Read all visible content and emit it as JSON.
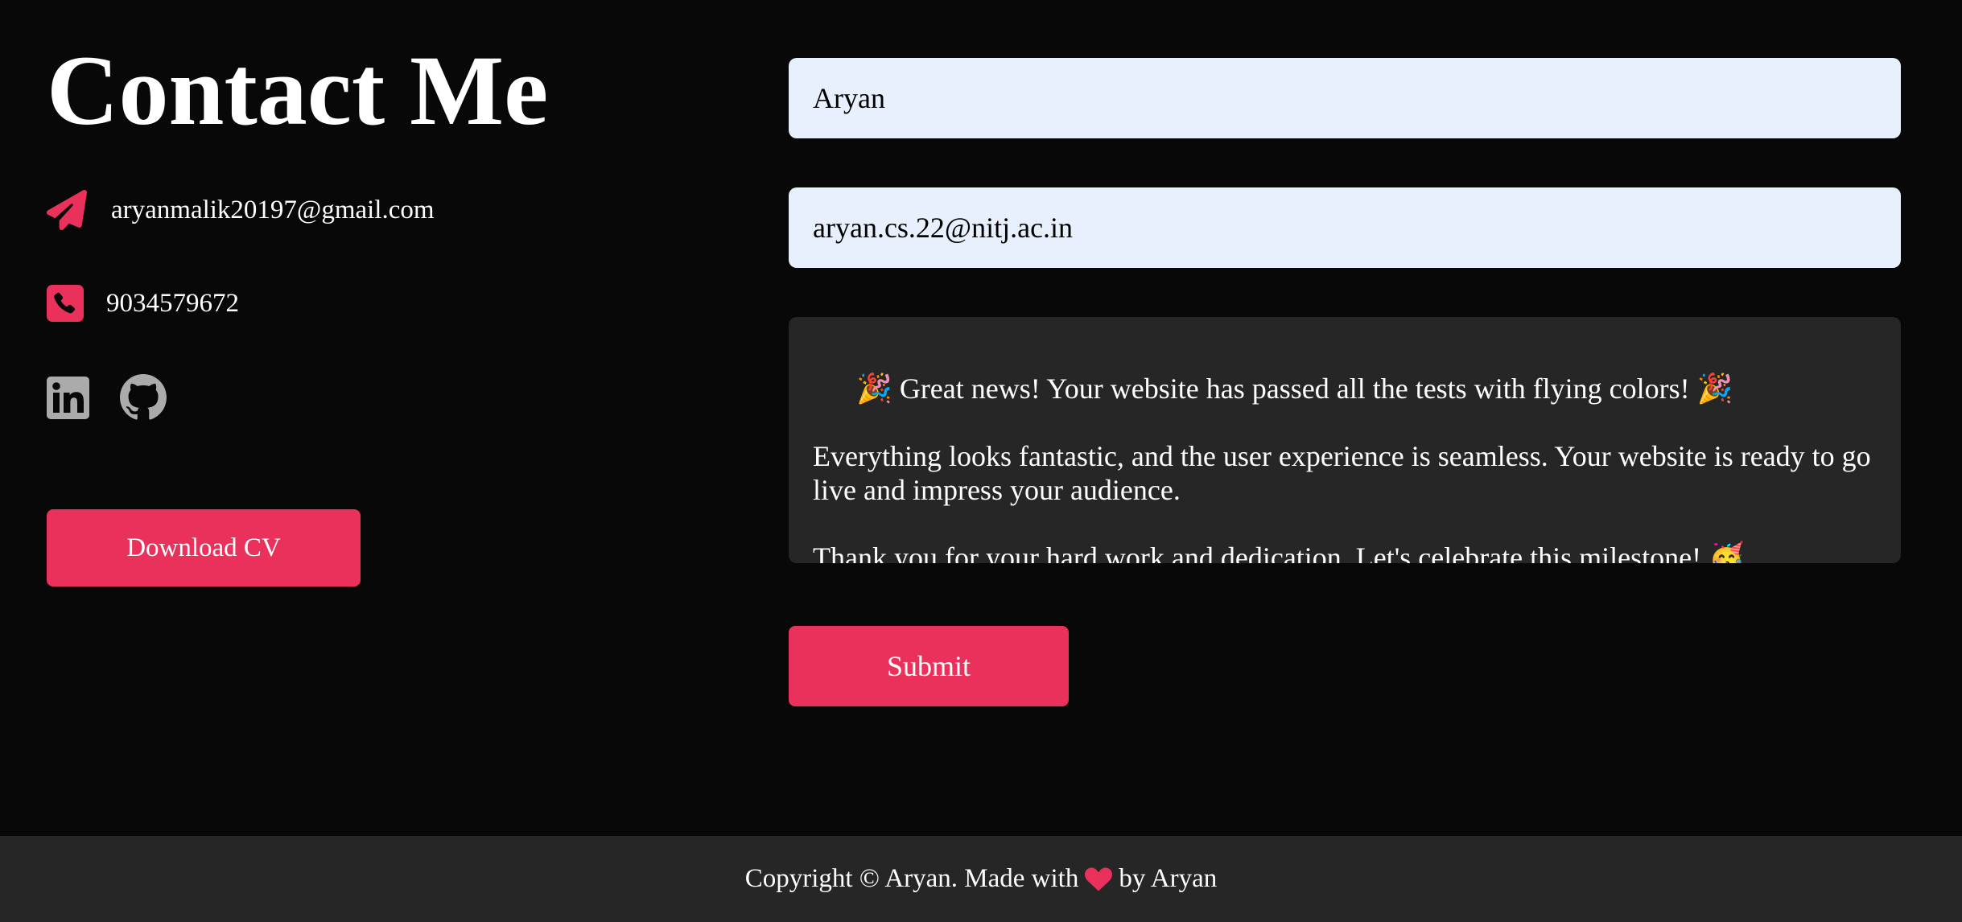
{
  "contact": {
    "title": "Contact Me",
    "email": "aryanmalik20197@gmail.com",
    "phone": "9034579672",
    "email_icon": "paper-plane-icon",
    "phone_icon": "phone-square-icon",
    "socials": [
      {
        "name": "LinkedIn",
        "icon": "linkedin-icon"
      },
      {
        "name": "GitHub",
        "icon": "github-icon"
      }
    ],
    "download_label": "Download CV"
  },
  "form": {
    "name_value": "Aryan",
    "email_value": "aryan.cs.22@nitj.ac.in",
    "message_value": "🎉 Great news! Your website has passed all the tests with flying colors! 🎉\n\nEverything looks fantastic, and the user experience is seamless. Your website is ready to go live and impress your audience.\n\nThank you for your hard work and dedication. Let's celebrate this milestone! 🥳",
    "submit_label": "Submit"
  },
  "footer": {
    "text_before": "Copyright © Aryan. Made with",
    "text_after": "by Aryan",
    "heart_icon": "heart-icon"
  },
  "colors": {
    "background": "#080808",
    "accent": "#e9315b",
    "input_background": "#e8f0fe",
    "textarea_background": "#262626",
    "footer_background": "#262626",
    "social_icon_color": "#ababab"
  }
}
